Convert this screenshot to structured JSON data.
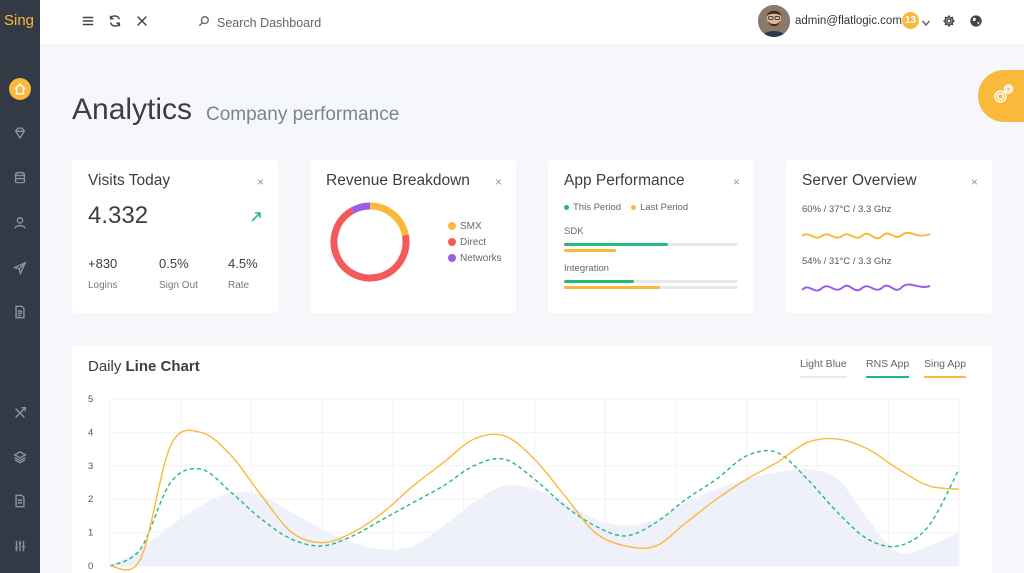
{
  "brand": "Sing",
  "sidebar": {
    "items": [
      {
        "icon": "home-icon",
        "active": true
      },
      {
        "icon": "diamond-icon"
      },
      {
        "icon": "database-icon"
      },
      {
        "icon": "user-icon"
      },
      {
        "icon": "send-icon"
      },
      {
        "icon": "document-icon"
      },
      {
        "icon": "tools-icon"
      },
      {
        "icon": "layers-icon"
      },
      {
        "icon": "file-icon"
      },
      {
        "icon": "sliders-icon"
      }
    ]
  },
  "header": {
    "search_placeholder": "Search Dashboard",
    "user_email": "admin@flatlogic.com",
    "notification_count": "13"
  },
  "page": {
    "title": "Analytics",
    "subtitle": "Company performance"
  },
  "visits": {
    "title": "Visits Today",
    "close": "×",
    "value": "4.332",
    "stats": [
      {
        "value": "+830",
        "label": "Logins"
      },
      {
        "value": "0.5%",
        "label": "Sign Out"
      },
      {
        "value": "4.5%",
        "label": "Rate"
      }
    ]
  },
  "revenue": {
    "title": "Revenue Breakdown",
    "close": "×",
    "legend": [
      {
        "label": "SMX",
        "color": "#fbb93b"
      },
      {
        "label": "Direct",
        "color": "#f45a5a"
      },
      {
        "label": "Networks",
        "color": "#9b5de5"
      }
    ],
    "slices": [
      22,
      70,
      8
    ]
  },
  "app_perf": {
    "title": "App Performance",
    "close": "×",
    "legend": [
      {
        "label": "This Period",
        "color": "#22b97a"
      },
      {
        "label": "Last Period",
        "color": "#fbb93b"
      }
    ],
    "rows": [
      {
        "label": "SDK",
        "this": 60,
        "last": 30
      },
      {
        "label": "Integration",
        "this": 40,
        "last": 55
      }
    ]
  },
  "server": {
    "title": "Server Overview",
    "close": "×",
    "rows": [
      {
        "label": "60% / 37°C / 3.3 Ghz",
        "color": "#fbb93b"
      },
      {
        "label": "54% / 31°C / 3.3 Ghz",
        "color": "#9b5de5"
      }
    ]
  },
  "line_chart": {
    "title_light": "Daily",
    "title_bold": "Line Chart",
    "legend": [
      {
        "label": "Light Blue",
        "color": "#e6e8f8"
      },
      {
        "label": "RNS App",
        "color": "#22b97a"
      },
      {
        "label": "Sing App",
        "color": "#fbb93b"
      }
    ]
  },
  "chart_data": {
    "type": "line",
    "y_ticks": [
      "0",
      "1",
      "2",
      "3",
      "4",
      "5"
    ],
    "ylim": [
      0,
      5
    ],
    "x": [
      0,
      1,
      2,
      3,
      4,
      5,
      6,
      7,
      8,
      9,
      10,
      11,
      12,
      13,
      14,
      15,
      16,
      17,
      18,
      19,
      20,
      21,
      22,
      23,
      24,
      25,
      26,
      27,
      28
    ],
    "series": [
      {
        "name": "Light Blue",
        "type": "area",
        "color": "#eef0fa",
        "values": [
          0,
          0.5,
          1.2,
          1.8,
          2.2,
          2.1,
          1.6,
          1.1,
          0.7,
          0.5,
          0.6,
          1.2,
          1.9,
          2.4,
          2.3,
          1.9,
          1.4,
          1.2,
          1.4,
          1.9,
          2.3,
          2.6,
          2.8,
          2.9,
          2.6,
          1.4,
          0.4,
          0.6,
          1.0
        ]
      },
      {
        "name": "RNS App",
        "type": "dashed",
        "color": "#22b97a",
        "values": [
          0,
          0.5,
          2.5,
          2.9,
          2.2,
          1.4,
          0.8,
          0.6,
          0.9,
          1.4,
          1.9,
          2.4,
          3.0,
          3.2,
          2.6,
          1.8,
          1.2,
          0.9,
          1.3,
          2.0,
          2.6,
          3.3,
          3.4,
          2.6,
          1.6,
          0.8,
          0.6,
          1.2,
          2.9
        ]
      },
      {
        "name": "Sing App",
        "type": "solid",
        "color": "#fbb93b",
        "values": [
          0,
          0.2,
          3.6,
          4.0,
          3.3,
          2.1,
          1.0,
          0.7,
          1.0,
          1.6,
          2.4,
          3.1,
          3.8,
          3.9,
          3.2,
          2.1,
          1.0,
          0.6,
          0.6,
          1.3,
          2.0,
          2.6,
          3.1,
          3.7,
          3.8,
          3.5,
          2.9,
          2.4,
          2.3
        ]
      }
    ]
  }
}
